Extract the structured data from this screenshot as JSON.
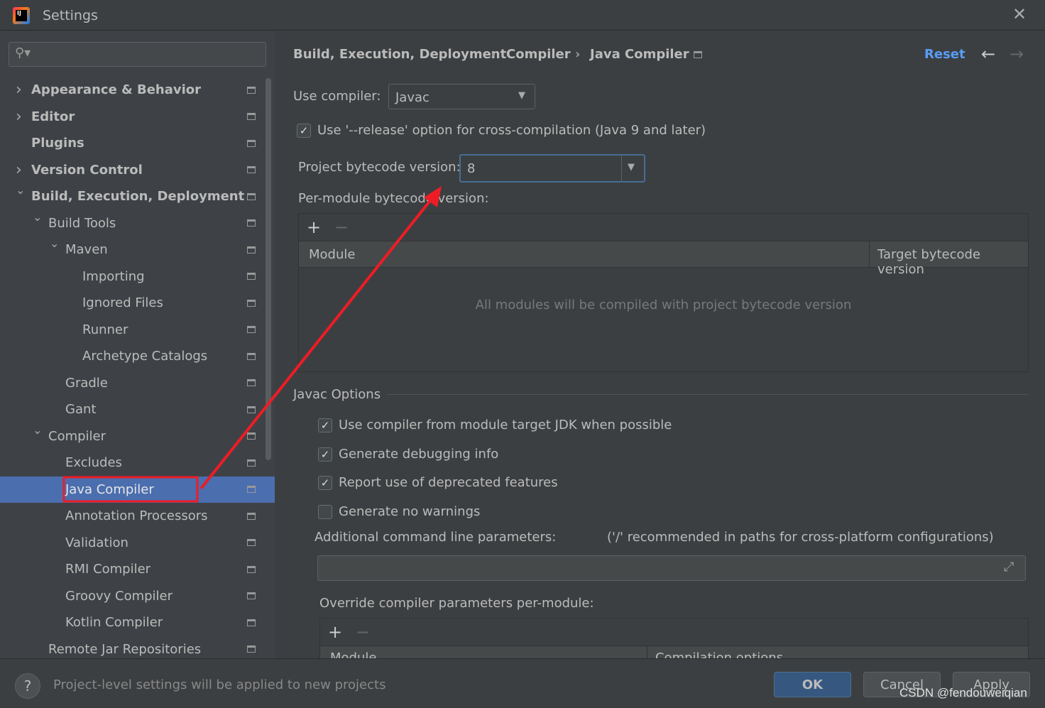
{
  "window": {
    "title": "Settings",
    "close_icon": "close-icon",
    "app_icon": "intellij-logo-icon"
  },
  "search": {
    "placeholder": ""
  },
  "tree": [
    {
      "label": "Appearance & Behavior",
      "level": 0,
      "expand": "collapsed",
      "bold": true
    },
    {
      "label": "Editor",
      "level": 0,
      "expand": "collapsed",
      "bold": true
    },
    {
      "label": "Plugins",
      "level": 0,
      "expand": "none",
      "bold": true
    },
    {
      "label": "Version Control",
      "level": 0,
      "expand": "collapsed",
      "bold": true
    },
    {
      "label": "Build, Execution, Deployment",
      "level": 0,
      "expand": "expanded",
      "bold": true
    },
    {
      "label": "Build Tools",
      "level": 1,
      "expand": "expanded"
    },
    {
      "label": "Maven",
      "level": 2,
      "expand": "expanded"
    },
    {
      "label": "Importing",
      "level": 3,
      "expand": "none"
    },
    {
      "label": "Ignored Files",
      "level": 3,
      "expand": "none"
    },
    {
      "label": "Runner",
      "level": 3,
      "expand": "none"
    },
    {
      "label": "Archetype Catalogs",
      "level": 3,
      "expand": "none"
    },
    {
      "label": "Gradle",
      "level": 2,
      "expand": "none"
    },
    {
      "label": "Gant",
      "level": 2,
      "expand": "none"
    },
    {
      "label": "Compiler",
      "level": 1,
      "expand": "expanded"
    },
    {
      "label": "Excludes",
      "level": 2,
      "expand": "none"
    },
    {
      "label": "Java Compiler",
      "level": 2,
      "expand": "none",
      "selected": true
    },
    {
      "label": "Annotation Processors",
      "level": 2,
      "expand": "none"
    },
    {
      "label": "Validation",
      "level": 2,
      "expand": "none"
    },
    {
      "label": "RMI Compiler",
      "level": 2,
      "expand": "none"
    },
    {
      "label": "Groovy Compiler",
      "level": 2,
      "expand": "none"
    },
    {
      "label": "Kotlin Compiler",
      "level": 2,
      "expand": "none"
    },
    {
      "label": "Remote Jar Repositories",
      "level": 1,
      "expand": "none"
    }
  ],
  "breadcrumb": [
    "Build, Execution, Deployment",
    "Compiler",
    "Java Compiler"
  ],
  "header": {
    "reset": "Reset",
    "back_icon": "arrow-left-icon",
    "forward_icon": "arrow-right-icon"
  },
  "compiler": {
    "label": "Use compiler:",
    "value": "Javac"
  },
  "release_option": {
    "label": "Use '--release' option for cross-compilation (Java 9 and later)",
    "checked": true
  },
  "bytecode": {
    "label": "Project bytecode version:",
    "value": "8"
  },
  "per_module": {
    "label": "Per-module bytecode version:",
    "columns": [
      "Module",
      "Target bytecode version"
    ],
    "empty": "All modules will be compiled with project bytecode version"
  },
  "javac": {
    "title": "Javac Options",
    "options": [
      {
        "label": "Use compiler from module target JDK when possible",
        "checked": true
      },
      {
        "label": "Generate debugging info",
        "checked": true
      },
      {
        "label": "Report use of deprecated features",
        "checked": true
      },
      {
        "label": "Generate no warnings",
        "checked": false
      }
    ],
    "params_label": "Additional command line parameters:",
    "params_hint": "('/' recommended in paths for cross-platform configurations)",
    "params_value": "",
    "override_label": "Override compiler parameters per-module:",
    "override_columns": [
      "Module",
      "Compilation options"
    ]
  },
  "footer": {
    "hint": "Project-level settings will be applied to new projects",
    "ok": "OK",
    "cancel": "Cancel",
    "apply": "Apply",
    "watermark": "CSDN @fendouweiqian"
  },
  "colors": {
    "selection": "#4b6eaf",
    "link": "#589df6",
    "annotation": "#ee1c25"
  }
}
